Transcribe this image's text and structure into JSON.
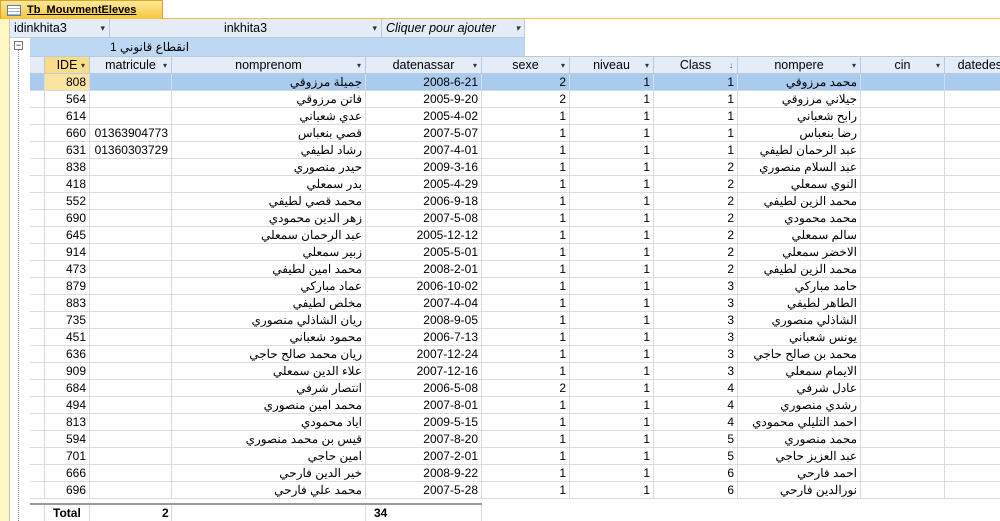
{
  "tab": {
    "title": "Tb_MouvmentEleves"
  },
  "group_columns": [
    {
      "label": "idinkhita3",
      "dropdown": "▾"
    },
    {
      "label": "inkhita3",
      "dropdown": "▾"
    },
    {
      "label": "Cliquer pour ajouter",
      "dropdown": "▾"
    }
  ],
  "group_row": {
    "toggle": "−",
    "text": "1 انقطاع قانوني"
  },
  "columns": [
    {
      "label": "IDE",
      "sort": "▾"
    },
    {
      "label": "matricule",
      "sort": "▾"
    },
    {
      "label": "nomprenom",
      "sort": "▾"
    },
    {
      "label": "datenassar",
      "sort": "▾"
    },
    {
      "label": "sexe",
      "sort": "▾"
    },
    {
      "label": "niveau",
      "sort": "▾"
    },
    {
      "label": "Class",
      "sort": "↓"
    },
    {
      "label": "nompere",
      "sort": "▾"
    },
    {
      "label": "cin",
      "sort": "▾"
    },
    {
      "label": "datedesorti",
      "sort": "▾"
    }
  ],
  "rows": [
    [
      "808",
      "",
      "جميلة مرزوقي",
      "2008-6-21",
      "2",
      "1",
      "1",
      "محمد مرزوقي",
      "",
      ""
    ],
    [
      "564",
      "",
      "فاتن مرزوقي",
      "2005-9-20",
      "2",
      "1",
      "1",
      "جيلاني مرزوقي",
      "",
      ""
    ],
    [
      "614",
      "",
      "عدي شعباني",
      "2005-4-02",
      "1",
      "1",
      "1",
      "رابح شعباني",
      "",
      ""
    ],
    [
      "660",
      "01363904773",
      "قصي بنعباس",
      "2007-5-07",
      "1",
      "1",
      "1",
      "رضا بنعباس",
      "",
      ""
    ],
    [
      "631",
      "01360303729",
      "رشاد لطيفي",
      "2007-4-01",
      "1",
      "1",
      "1",
      "عبد الرحمان لطيفي",
      "",
      ""
    ],
    [
      "838",
      "",
      "حيدر منصوري",
      "2009-3-16",
      "1",
      "1",
      "2",
      "عبد السلام منصوري",
      "",
      ""
    ],
    [
      "418",
      "",
      "بدر سمعلي",
      "2005-4-29",
      "1",
      "1",
      "2",
      "النوي سمعلي",
      "",
      ""
    ],
    [
      "552",
      "",
      "محمد قصي لطيفي",
      "2006-9-18",
      "1",
      "1",
      "2",
      "محمد الزين لطيفي",
      "",
      ""
    ],
    [
      "690",
      "",
      "زهر الدين محمودي",
      "2007-5-08",
      "1",
      "1",
      "2",
      "محمد محمودي",
      "",
      ""
    ],
    [
      "645",
      "",
      "عبد الرحمان سمعلي",
      "2005-12-12",
      "1",
      "1",
      "2",
      "سالم سمعلي",
      "",
      ""
    ],
    [
      "914",
      "",
      "زبير سمعلي",
      "2005-5-01",
      "1",
      "1",
      "2",
      "الاخضر سمعلي",
      "",
      ""
    ],
    [
      "473",
      "",
      "محمد امين لطيفي",
      "2008-2-01",
      "1",
      "1",
      "2",
      "محمد الزين لطيفي",
      "",
      ""
    ],
    [
      "879",
      "",
      "عماد مباركي",
      "2006-10-02",
      "1",
      "1",
      "3",
      "حامد مباركي",
      "",
      ""
    ],
    [
      "883",
      "",
      "مخلص لطيفي",
      "2007-4-04",
      "1",
      "1",
      "3",
      "الطاهر لطيفي",
      "",
      ""
    ],
    [
      "735",
      "",
      "ريان الشاذلي منصوري",
      "2008-9-05",
      "1",
      "1",
      "3",
      "الشاذلي منصوري",
      "",
      ""
    ],
    [
      "451",
      "",
      "محمود شعباني",
      "2006-7-13",
      "1",
      "1",
      "3",
      "يونس شعباني",
      "",
      ""
    ],
    [
      "636",
      "",
      "ريان محمد صالح حاجي",
      "2007-12-24",
      "1",
      "1",
      "3",
      "محمد بن صالح حاجي",
      "",
      ""
    ],
    [
      "909",
      "",
      "علاء الدين سمعلي",
      "2007-12-16",
      "1",
      "1",
      "3",
      "الايمام سمعلي",
      "",
      ""
    ],
    [
      "684",
      "",
      "انتصار شرفي",
      "2006-5-08",
      "2",
      "1",
      "4",
      "عادل شرفي",
      "",
      ""
    ],
    [
      "494",
      "",
      "محمد امين منصوري",
      "2007-8-01",
      "1",
      "1",
      "4",
      "رشدي منصوري",
      "",
      ""
    ],
    [
      "813",
      "",
      "اياد محمودي",
      "2009-5-15",
      "1",
      "1",
      "4",
      "احمد التليلي محمودي",
      "",
      ""
    ],
    [
      "594",
      "",
      "قيس بن محمد منصوري",
      "2007-8-20",
      "1",
      "1",
      "5",
      "محمد منصوري",
      "",
      ""
    ],
    [
      "701",
      "",
      "امين حاجي",
      "2007-2-01",
      "1",
      "1",
      "5",
      "عبد العزيز حاجي",
      "",
      ""
    ],
    [
      "666",
      "",
      "خير الدين فارحي",
      "2008-9-22",
      "1",
      "1",
      "6",
      "احمد فارحي",
      "",
      ""
    ],
    [
      "696",
      "",
      "محمد علي فارحي",
      "2007-5-28",
      "1",
      "1",
      "6",
      "نورالدين فارحي",
      "",
      ""
    ]
  ],
  "totals": {
    "label": "Total",
    "count_matricule": "2",
    "count_datenassar": "34"
  }
}
